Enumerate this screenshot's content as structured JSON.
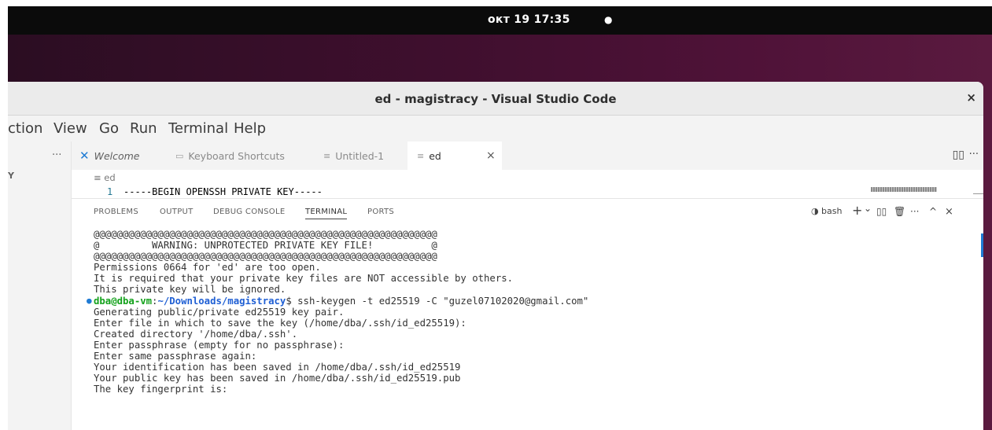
{
  "topbar": {
    "clock": "окт 19 17:35",
    "indicator": "●"
  },
  "window": {
    "title": "ed - magistracy - Visual Studio Code",
    "close": "×"
  },
  "menu": [
    "ction",
    "View",
    "Go",
    "Run",
    "Terminal",
    "Help"
  ],
  "sidebar": {
    "more": "···",
    "section_letter": "Y"
  },
  "tabs": [
    {
      "label": "Welcome",
      "icon": "vscode-logo-icon"
    },
    {
      "label": "Keyboard Shortcuts",
      "icon": "keyboard-icon"
    },
    {
      "label": "Untitled-1",
      "icon": "lines-icon"
    },
    {
      "label": "ed",
      "icon": "lines-icon",
      "active": true
    }
  ],
  "tab_close": "×",
  "editor_actions": {
    "split": "▯▯",
    "more": "···"
  },
  "editor": {
    "breadcrumb": "≡ ed",
    "line_number": "1",
    "line_text": "-----BEGIN OPENSSH PRIVATE KEY-----"
  },
  "panel": {
    "tabs": [
      "PROBLEMS",
      "OUTPUT",
      "DEBUG CONSOLE",
      "TERMINAL",
      "PORTS"
    ],
    "active_tab": "TERMINAL",
    "shell": "bash",
    "actions": {
      "add": "+",
      "dropdown": "⌄",
      "split": "▯▯",
      "trash": "🗑",
      "more": "···",
      "maximize": "^",
      "close": "×"
    }
  },
  "terminal": {
    "lines_before": [
      "@@@@@@@@@@@@@@@@@@@@@@@@@@@@@@@@@@@@@@@@@@@@@@@@@@@@@@@@@@@",
      "@         WARNING: UNPROTECTED PRIVATE KEY FILE!          @",
      "@@@@@@@@@@@@@@@@@@@@@@@@@@@@@@@@@@@@@@@@@@@@@@@@@@@@@@@@@@@",
      "Permissions 0664 for 'ed' are too open.",
      "It is required that your private key files are NOT accessible by others.",
      "This private key will be ignored."
    ],
    "prompt_user": "dba@dba-vm",
    "prompt_sep": ":",
    "prompt_path": "~/Downloads/magistracy",
    "prompt_cmd": "$ ssh-keygen -t ed25519 -C \"guzel07102020@gmail.com\"",
    "lines_after": [
      "Generating public/private ed25519 key pair.",
      "Enter file in which to save the key (/home/dba/.ssh/id_ed25519):",
      "Created directory '/home/dba/.ssh'.",
      "Enter passphrase (empty for no passphrase):",
      "Enter same passphrase again:",
      "Your identification has been saved in /home/dba/.ssh/id_ed25519",
      "Your public key has been saved in /home/dba/.ssh/id_ed25519.pub",
      "The key fingerprint is:"
    ]
  }
}
